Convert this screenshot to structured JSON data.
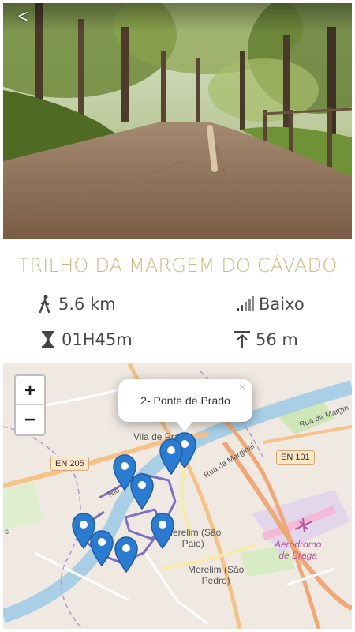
{
  "header": {
    "back_label": "<"
  },
  "trail": {
    "title": "TRILHO DA MARGEM DO CÁVADO",
    "distance": "5.6 km",
    "difficulty": "Baixo",
    "duration": "01H45m",
    "elevation": "56 m"
  },
  "icons": {
    "distance": "hiker-icon",
    "difficulty": "signal-bars-icon",
    "duration": "hourglass-icon",
    "elevation": "elevation-arrow-icon"
  },
  "map": {
    "zoom_in_label": "+",
    "zoom_out_label": "−",
    "popup_text": "2- Ponte de Prado",
    "popup_close": "×",
    "labels": {
      "vila": "Vila de Prado",
      "merelim_paio": "Merelim (São\nPaio)",
      "merelim_pedro": "Merelim (São\nPedro)",
      "airport": "Aeródromo\nde Braga",
      "en205": "EN 205",
      "en101": "EN 101",
      "rua_marginal": "Rua da Marginal",
      "rua_marg2": "Rua da Margin",
      "rio": "Rio",
      "s": "s"
    },
    "colors": {
      "pin": "#2b7bd1",
      "route": "#7b6fc8",
      "river": "#a8cfe6",
      "title": "#c4bb84"
    }
  }
}
